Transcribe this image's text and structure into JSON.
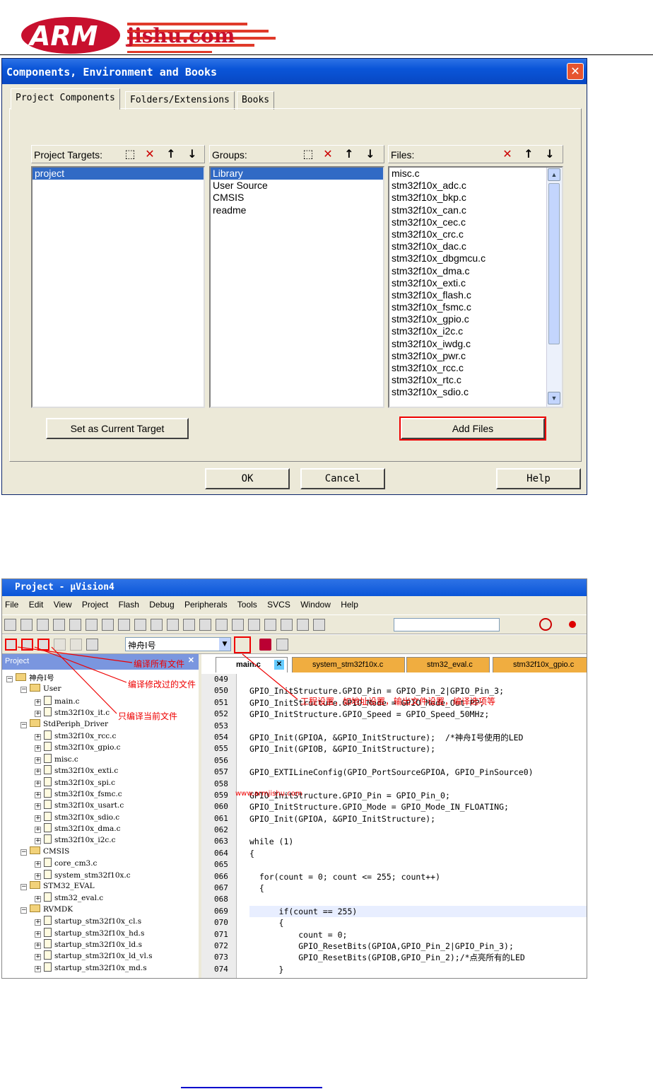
{
  "logo": {
    "text": "ARM",
    "sub": "jishu.com"
  },
  "dialog": {
    "title": "Components, Environment and Books",
    "tabs": [
      "Project Components",
      "Folders/Extensions",
      "Books"
    ],
    "targets": {
      "label": "Project Targets:",
      "items": [
        "project"
      ]
    },
    "groups": {
      "label": "Groups:",
      "items": [
        "Library",
        "User Source",
        "CMSIS",
        "readme"
      ]
    },
    "files": {
      "label": "Files:",
      "items": [
        "misc.c",
        "stm32f10x_adc.c",
        "stm32f10x_bkp.c",
        "stm32f10x_can.c",
        "stm32f10x_cec.c",
        "stm32f10x_crc.c",
        "stm32f10x_dac.c",
        "stm32f10x_dbgmcu.c",
        "stm32f10x_dma.c",
        "stm32f10x_exti.c",
        "stm32f10x_flash.c",
        "stm32f10x_fsmc.c",
        "stm32f10x_gpio.c",
        "stm32f10x_i2c.c",
        "stm32f10x_iwdg.c",
        "stm32f10x_pwr.c",
        "stm32f10x_rcc.c",
        "stm32f10x_rtc.c",
        "stm32f10x_sdio.c"
      ]
    },
    "set_target": "Set as Current Target",
    "add_files": "Add Files",
    "ok": "OK",
    "cancel": "Cancel",
    "help": "Help"
  },
  "uvision": {
    "title": "Project  - µVision4",
    "menu": [
      "File",
      "Edit",
      "View",
      "Project",
      "Flash",
      "Debug",
      "Peripherals",
      "Tools",
      "SVCS",
      "Window",
      "Help"
    ],
    "target_select": "神舟I号",
    "project_panel": "Project",
    "tree": [
      {
        "t": "神舟I号",
        "lvl": 0,
        "kind": "root"
      },
      {
        "t": "User",
        "lvl": 1,
        "kind": "folder"
      },
      {
        "t": "main.c",
        "lvl": 2,
        "kind": "file"
      },
      {
        "t": "stm32f10x_it.c",
        "lvl": 2,
        "kind": "file"
      },
      {
        "t": "StdPeriph_Driver",
        "lvl": 1,
        "kind": "folder"
      },
      {
        "t": "stm32f10x_rcc.c",
        "lvl": 2,
        "kind": "file"
      },
      {
        "t": "stm32f10x_gpio.c",
        "lvl": 2,
        "kind": "file"
      },
      {
        "t": "misc.c",
        "lvl": 2,
        "kind": "file"
      },
      {
        "t": "stm32f10x_exti.c",
        "lvl": 2,
        "kind": "file"
      },
      {
        "t": "stm32f10x_spi.c",
        "lvl": 2,
        "kind": "file"
      },
      {
        "t": "stm32f10x_fsmc.c",
        "lvl": 2,
        "kind": "file"
      },
      {
        "t": "stm32f10x_usart.c",
        "lvl": 2,
        "kind": "file"
      },
      {
        "t": "stm32f10x_sdio.c",
        "lvl": 2,
        "kind": "file"
      },
      {
        "t": "stm32f10x_dma.c",
        "lvl": 2,
        "kind": "file"
      },
      {
        "t": "stm32f10x_i2c.c",
        "lvl": 2,
        "kind": "file"
      },
      {
        "t": "CMSIS",
        "lvl": 1,
        "kind": "folder"
      },
      {
        "t": "core_cm3.c",
        "lvl": 2,
        "kind": "file"
      },
      {
        "t": "system_stm32f10x.c",
        "lvl": 2,
        "kind": "file"
      },
      {
        "t": "STM32_EVAL",
        "lvl": 1,
        "kind": "folder"
      },
      {
        "t": "stm32_eval.c",
        "lvl": 2,
        "kind": "file"
      },
      {
        "t": "RVMDK",
        "lvl": 1,
        "kind": "folder"
      },
      {
        "t": "startup_stm32f10x_cl.s",
        "lvl": 2,
        "kind": "file"
      },
      {
        "t": "startup_stm32f10x_hd.s",
        "lvl": 2,
        "kind": "file"
      },
      {
        "t": "startup_stm32f10x_ld.s",
        "lvl": 2,
        "kind": "file"
      },
      {
        "t": "startup_stm32f10x_ld_vl.s",
        "lvl": 2,
        "kind": "file"
      },
      {
        "t": "startup_stm32f10x_md.s",
        "lvl": 2,
        "kind": "file"
      }
    ],
    "editor_tabs": [
      "main.c",
      "system_stm32f10x.c",
      "stm32_eval.c",
      "stm32f10x_gpio.c"
    ],
    "line_numbers": [
      "049",
      "050",
      "051",
      "052",
      "053",
      "054",
      "055",
      "056",
      "057",
      "058",
      "059",
      "060",
      "061",
      "062",
      "063",
      "064",
      "065",
      "066",
      "067",
      "068",
      "069",
      "070",
      "071",
      "072",
      "073",
      "074"
    ],
    "code": [
      "",
      "GPIO_InitStructure.GPIO_Pin = GPIO_Pin_2|GPIO_Pin_3;",
      "GPIO_InitStructure.GPIO_Mode = GPIO_Mode_Out_PP;",
      "GPIO_InitStructure.GPIO_Speed = GPIO_Speed_50MHz;",
      "",
      "GPIO_Init(GPIOA, &GPIO_InitStructure);  /*神舟I号使用的LED",
      "GPIO_Init(GPIOB, &GPIO_InitStructure);",
      "",
      "GPIO_EXTILineConfig(GPIO_PortSourceGPIOA, GPIO_PinSource0)",
      "",
      "GPIO_InitStructure.GPIO_Pin = GPIO_Pin_0;",
      "GPIO_InitStructure.GPIO_Mode = GPIO_Mode_IN_FLOATING;",
      "GPIO_Init(GPIOA, &GPIO_InitStructure);",
      "",
      "while (1)",
      "{",
      "",
      "  for(count = 0; count <= 255; count++)",
      "  {",
      "",
      "      if(count == 255)",
      "      {",
      "          count = 0;",
      "          GPIO_ResetBits(GPIOA,GPIO_Pin_2|GPIO_Pin_3);",
      "          GPIO_ResetBits(GPIOB,GPIO_Pin_2);/*点亮所有的LED",
      "      }"
    ],
    "annotations": {
      "build_all": "编译所有文件",
      "build_changed": "编译修改过的文件",
      "compile_current": "只编译当前文件",
      "options": "工程设置，如地址设置，输出文件设置，编译选项等",
      "watermark": "www.armjishu.com"
    }
  }
}
